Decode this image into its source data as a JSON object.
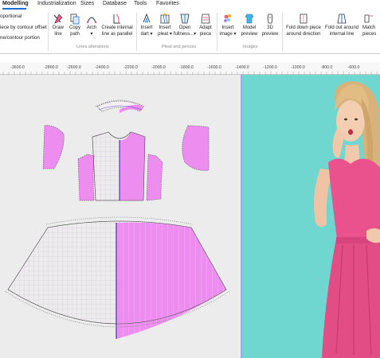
{
  "menu": {
    "items": [
      "Modelling",
      "Industrialization",
      "Sizes",
      "Database",
      "Tools",
      "Favorites"
    ]
  },
  "ribbon": {
    "left_options": [
      "oportional",
      "iece by contour offset",
      "ne/contour portion"
    ],
    "buttons": [
      {
        "label1": "Draw",
        "label2": "line",
        "icon": "draw-line-icon"
      },
      {
        "label1": "Copy",
        "label2": "path",
        "icon": "copy-path-icon"
      },
      {
        "label1": "Arch",
        "label2": "▾",
        "icon": "arch-icon"
      },
      {
        "label1": "Create internal",
        "label2": "line as parallel",
        "icon": "internal-line-icon"
      },
      {
        "label1": "Insert",
        "label2": "dart ▾",
        "icon": "insert-dart-icon"
      },
      {
        "label1": "Insert",
        "label2": "pleat ▾",
        "icon": "insert-pleat-icon"
      },
      {
        "label1": "Open",
        "label2": "fullness...▾",
        "icon": "open-fullness-icon"
      },
      {
        "label1": "Adapt",
        "label2": "piece",
        "icon": "adapt-piece-icon"
      },
      {
        "label1": "Insert",
        "label2": "image ▾",
        "icon": "insert-image-icon"
      },
      {
        "label1": "Model",
        "label2": "preview",
        "icon": "model-preview-icon"
      },
      {
        "label1": "3D",
        "label2": "preview",
        "icon": "3d-preview-icon"
      },
      {
        "label1": "Fold down piece",
        "label2": "around direction",
        "icon": "fold-down-icon"
      },
      {
        "label1": "Fold out around",
        "label2": "internal line",
        "icon": "fold-out-icon"
      },
      {
        "label1": "Match",
        "label2": "pieces",
        "icon": "match-pieces-icon"
      }
    ],
    "groups": [
      "Lines alterations",
      "Pleat and pences",
      "Images"
    ]
  },
  "ruler": {
    "ticks": [
      "-3600.0",
      "-2800.0",
      "-2600.0",
      "-2400.0",
      "-2200.0",
      "-2000.0",
      "-1800.0",
      "-1600.0",
      "-1400.0",
      "-1200.0",
      "-1000.0",
      "-800.0",
      "-600.0"
    ]
  },
  "colors": {
    "piece_fill": "#ee8df0",
    "piece_light": "#f4eef5",
    "seam": "#2a2ab8",
    "photo_bg": "#6fd6d0",
    "dress": "#e9528c",
    "accent": "#1d6fd6"
  }
}
